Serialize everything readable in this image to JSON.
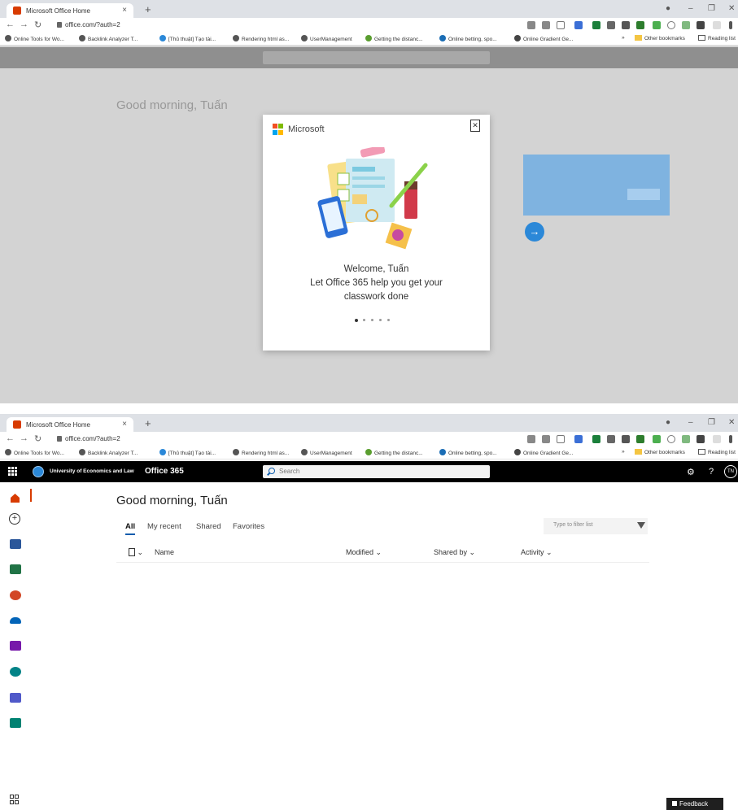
{
  "browser": {
    "tab_title": "Microsoft Office Home",
    "tab_close": "×",
    "new_tab": "+",
    "url_1": "office.com/?auth=2",
    "url_2": "office.com/?auth=2",
    "bookmarks": [
      "Online Tools for Wo...",
      "Backlink Analyzer T...",
      "[Thủ thuật] Tạo tài...",
      "Rendering html as...",
      "UserManagement",
      "Getting the distanc...",
      "Online betting, spo...",
      "Online Gradient Ge..."
    ],
    "bookmarks_more": "»",
    "other_bookmarks": "Other bookmarks",
    "reading_list": "Reading list"
  },
  "header": {
    "org_name": "University of Economics and Law",
    "app_name": "Office 365",
    "search_placeholder": "Search",
    "settings_icon": "⚙",
    "help_icon": "?",
    "avatar_initials": "TN"
  },
  "main": {
    "greeting": "Good morning, Tuấn",
    "tabs": [
      "All",
      "My recent",
      "Shared",
      "Favorites"
    ],
    "filter_placeholder": "Type to filter list",
    "columns": [
      "Name",
      "Modified",
      "Shared by",
      "Activity"
    ]
  },
  "dialog": {
    "brand": "Microsoft",
    "close": "✕",
    "welcome": "Welcome, Tuấn",
    "message_line1": "Let Office 365 help you get your",
    "message_line2": "classwork done",
    "carousel_count": 5,
    "carousel_active": 1,
    "next_arrow": "→"
  },
  "feedback": "Feedback",
  "colors": {
    "accent": "#0b5cad",
    "office_red": "#d83b01",
    "header_bg": "#000000",
    "next_button": "#2b88d8"
  },
  "icons": {
    "rail": [
      "home-icon",
      "create-icon",
      "word-icon",
      "excel-icon",
      "powerpoint-icon",
      "onedrive-icon",
      "onenote-icon",
      "sharepoint-icon",
      "teams-icon",
      "sway-icon",
      "all-apps-icon"
    ]
  }
}
